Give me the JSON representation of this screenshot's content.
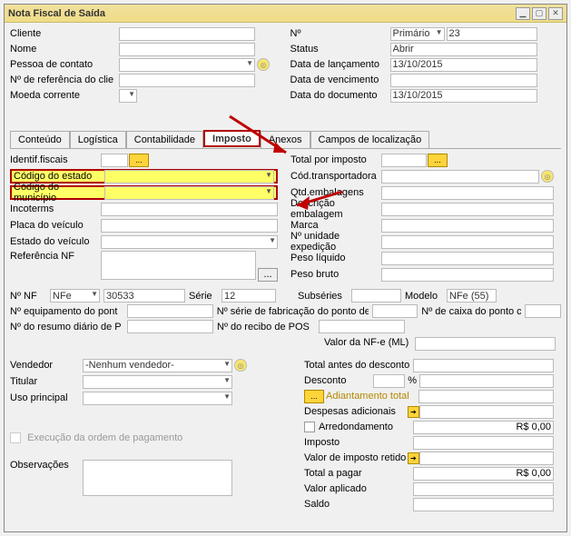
{
  "window": {
    "title": "Nota Fiscal de Saída"
  },
  "header_left": {
    "cliente_lbl": "Cliente",
    "nome_lbl": "Nome",
    "contato_lbl": "Pessoa de contato",
    "ref_lbl": "Nº de referência do clie",
    "moeda_lbl": "Moeda corrente"
  },
  "header_right": {
    "num_lbl": "Nº",
    "num_type": "Primário",
    "num_val": "23",
    "status_lbl": "Status",
    "status_val": "Abrir",
    "lanc_lbl": "Data de lançamento",
    "lanc_val": "13/10/2015",
    "venc_lbl": "Data de vencimento",
    "venc_val": "",
    "doc_lbl": "Data do documento",
    "doc_val": "13/10/2015"
  },
  "tabs": {
    "conteudo": "Conteúdo",
    "logistica": "Logística",
    "contabilidade": "Contabilidade",
    "imposto": "Imposto",
    "anexos": "Anexos",
    "campos": "Campos de localização"
  },
  "imposto_left": {
    "identif_lbl": "Identif.fiscais",
    "cod_estado_lbl": "Código do estado",
    "cod_mun_lbl": "Código do município",
    "incoterms_lbl": "Incoterms",
    "placa_lbl": "Placa do veículo",
    "estado_veic_lbl": "Estado do veículo",
    "ref_nf_lbl": "Referência NF"
  },
  "imposto_right": {
    "total_imp_lbl": "Total por imposto",
    "cod_transp_lbl": "Cód.transportadora",
    "qtd_emb_lbl": "Qtd.embalagens",
    "descr_emb_lbl": "Descrição embalagem",
    "marca_lbl": "Marca",
    "unid_lbl": "Nº unidade expedição",
    "peso_liq_lbl": "Peso líquido",
    "peso_bruto_lbl": "Peso bruto"
  },
  "nf_line": {
    "num_nf_lbl": "Nº NF",
    "num_nf_type": "NFe",
    "num_nf_val": "30533",
    "serie_lbl": "Série",
    "serie_val": "12",
    "subseries_lbl": "Subséries",
    "modelo_lbl": "Modelo",
    "modelo_val": "NFe (55)",
    "eq_lbl": "Nº equipamento do pont",
    "serie_fab_lbl": "Nº série de fabricação do ponto de",
    "caixa_lbl": "Nº de caixa do ponto c",
    "resumo_lbl": "Nº do resumo diário de P",
    "recibo_lbl": "Nº do recibo de POS",
    "valor_nfe_lbl": "Valor da NF-e (ML)"
  },
  "footer_left": {
    "vendedor_lbl": "Vendedor",
    "vendedor_val": "-Nenhum vendedor-",
    "titular_lbl": "Titular",
    "uso_lbl": "Uso principal",
    "exec_lbl": "Execução da ordem de pagamento",
    "obs_lbl": "Observações"
  },
  "totals": {
    "antes_lbl": "Total antes do desconto",
    "desconto_lbl": "Desconto",
    "pct": "%",
    "adiant_lbl": "Adiantamento total",
    "desp_lbl": "Despesas adicionais",
    "arred_lbl": "Arredondamento",
    "arred_val": "R$ 0,00",
    "imposto_lbl": "Imposto",
    "retido_lbl": "Valor de imposto retido",
    "total_lbl": "Total a pagar",
    "total_val": "R$ 0,00",
    "aplicado_lbl": "Valor aplicado",
    "saldo_lbl": "Saldo"
  },
  "lookup_dots": "..."
}
